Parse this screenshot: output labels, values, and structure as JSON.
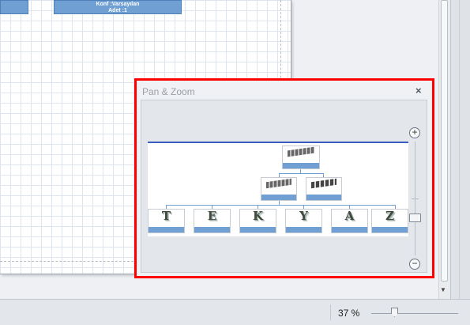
{
  "diagram": {
    "top_node_line1": "Konf :Varsayılan",
    "top_node_line2": "Adet :1"
  },
  "pan_zoom_panel": {
    "title": "Pan & Zoom",
    "close_symbol": "×",
    "zoom_in_symbol": "+",
    "zoom_out_symbol": "−",
    "preview_letters": [
      "T",
      "E",
      "K",
      "Y",
      "A",
      "Z"
    ]
  },
  "statusbar": {
    "zoom_level": "37 %"
  },
  "colors": {
    "highlight": "#ff0000",
    "node_fill": "#6f9fd3",
    "view_rect": "#3b5dbd"
  },
  "icons": [
    "close-icon",
    "zoom-in-icon",
    "zoom-out-icon"
  ]
}
